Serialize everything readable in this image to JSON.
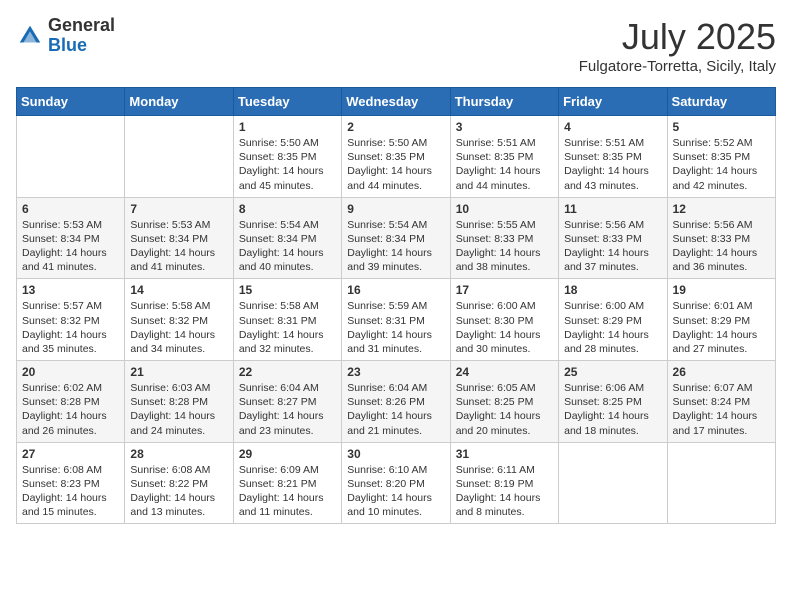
{
  "logo": {
    "general": "General",
    "blue": "Blue"
  },
  "title": "July 2025",
  "location": "Fulgatore-Torretta, Sicily, Italy",
  "days_of_week": [
    "Sunday",
    "Monday",
    "Tuesday",
    "Wednesday",
    "Thursday",
    "Friday",
    "Saturday"
  ],
  "weeks": [
    [
      {
        "day": "",
        "sunrise": "",
        "sunset": "",
        "daylight": ""
      },
      {
        "day": "",
        "sunrise": "",
        "sunset": "",
        "daylight": ""
      },
      {
        "day": "1",
        "sunrise": "Sunrise: 5:50 AM",
        "sunset": "Sunset: 8:35 PM",
        "daylight": "Daylight: 14 hours and 45 minutes."
      },
      {
        "day": "2",
        "sunrise": "Sunrise: 5:50 AM",
        "sunset": "Sunset: 8:35 PM",
        "daylight": "Daylight: 14 hours and 44 minutes."
      },
      {
        "day": "3",
        "sunrise": "Sunrise: 5:51 AM",
        "sunset": "Sunset: 8:35 PM",
        "daylight": "Daylight: 14 hours and 44 minutes."
      },
      {
        "day": "4",
        "sunrise": "Sunrise: 5:51 AM",
        "sunset": "Sunset: 8:35 PM",
        "daylight": "Daylight: 14 hours and 43 minutes."
      },
      {
        "day": "5",
        "sunrise": "Sunrise: 5:52 AM",
        "sunset": "Sunset: 8:35 PM",
        "daylight": "Daylight: 14 hours and 42 minutes."
      }
    ],
    [
      {
        "day": "6",
        "sunrise": "Sunrise: 5:53 AM",
        "sunset": "Sunset: 8:34 PM",
        "daylight": "Daylight: 14 hours and 41 minutes."
      },
      {
        "day": "7",
        "sunrise": "Sunrise: 5:53 AM",
        "sunset": "Sunset: 8:34 PM",
        "daylight": "Daylight: 14 hours and 41 minutes."
      },
      {
        "day": "8",
        "sunrise": "Sunrise: 5:54 AM",
        "sunset": "Sunset: 8:34 PM",
        "daylight": "Daylight: 14 hours and 40 minutes."
      },
      {
        "day": "9",
        "sunrise": "Sunrise: 5:54 AM",
        "sunset": "Sunset: 8:34 PM",
        "daylight": "Daylight: 14 hours and 39 minutes."
      },
      {
        "day": "10",
        "sunrise": "Sunrise: 5:55 AM",
        "sunset": "Sunset: 8:33 PM",
        "daylight": "Daylight: 14 hours and 38 minutes."
      },
      {
        "day": "11",
        "sunrise": "Sunrise: 5:56 AM",
        "sunset": "Sunset: 8:33 PM",
        "daylight": "Daylight: 14 hours and 37 minutes."
      },
      {
        "day": "12",
        "sunrise": "Sunrise: 5:56 AM",
        "sunset": "Sunset: 8:33 PM",
        "daylight": "Daylight: 14 hours and 36 minutes."
      }
    ],
    [
      {
        "day": "13",
        "sunrise": "Sunrise: 5:57 AM",
        "sunset": "Sunset: 8:32 PM",
        "daylight": "Daylight: 14 hours and 35 minutes."
      },
      {
        "day": "14",
        "sunrise": "Sunrise: 5:58 AM",
        "sunset": "Sunset: 8:32 PM",
        "daylight": "Daylight: 14 hours and 34 minutes."
      },
      {
        "day": "15",
        "sunrise": "Sunrise: 5:58 AM",
        "sunset": "Sunset: 8:31 PM",
        "daylight": "Daylight: 14 hours and 32 minutes."
      },
      {
        "day": "16",
        "sunrise": "Sunrise: 5:59 AM",
        "sunset": "Sunset: 8:31 PM",
        "daylight": "Daylight: 14 hours and 31 minutes."
      },
      {
        "day": "17",
        "sunrise": "Sunrise: 6:00 AM",
        "sunset": "Sunset: 8:30 PM",
        "daylight": "Daylight: 14 hours and 30 minutes."
      },
      {
        "day": "18",
        "sunrise": "Sunrise: 6:00 AM",
        "sunset": "Sunset: 8:29 PM",
        "daylight": "Daylight: 14 hours and 28 minutes."
      },
      {
        "day": "19",
        "sunrise": "Sunrise: 6:01 AM",
        "sunset": "Sunset: 8:29 PM",
        "daylight": "Daylight: 14 hours and 27 minutes."
      }
    ],
    [
      {
        "day": "20",
        "sunrise": "Sunrise: 6:02 AM",
        "sunset": "Sunset: 8:28 PM",
        "daylight": "Daylight: 14 hours and 26 minutes."
      },
      {
        "day": "21",
        "sunrise": "Sunrise: 6:03 AM",
        "sunset": "Sunset: 8:28 PM",
        "daylight": "Daylight: 14 hours and 24 minutes."
      },
      {
        "day": "22",
        "sunrise": "Sunrise: 6:04 AM",
        "sunset": "Sunset: 8:27 PM",
        "daylight": "Daylight: 14 hours and 23 minutes."
      },
      {
        "day": "23",
        "sunrise": "Sunrise: 6:04 AM",
        "sunset": "Sunset: 8:26 PM",
        "daylight": "Daylight: 14 hours and 21 minutes."
      },
      {
        "day": "24",
        "sunrise": "Sunrise: 6:05 AM",
        "sunset": "Sunset: 8:25 PM",
        "daylight": "Daylight: 14 hours and 20 minutes."
      },
      {
        "day": "25",
        "sunrise": "Sunrise: 6:06 AM",
        "sunset": "Sunset: 8:25 PM",
        "daylight": "Daylight: 14 hours and 18 minutes."
      },
      {
        "day": "26",
        "sunrise": "Sunrise: 6:07 AM",
        "sunset": "Sunset: 8:24 PM",
        "daylight": "Daylight: 14 hours and 17 minutes."
      }
    ],
    [
      {
        "day": "27",
        "sunrise": "Sunrise: 6:08 AM",
        "sunset": "Sunset: 8:23 PM",
        "daylight": "Daylight: 14 hours and 15 minutes."
      },
      {
        "day": "28",
        "sunrise": "Sunrise: 6:08 AM",
        "sunset": "Sunset: 8:22 PM",
        "daylight": "Daylight: 14 hours and 13 minutes."
      },
      {
        "day": "29",
        "sunrise": "Sunrise: 6:09 AM",
        "sunset": "Sunset: 8:21 PM",
        "daylight": "Daylight: 14 hours and 11 minutes."
      },
      {
        "day": "30",
        "sunrise": "Sunrise: 6:10 AM",
        "sunset": "Sunset: 8:20 PM",
        "daylight": "Daylight: 14 hours and 10 minutes."
      },
      {
        "day": "31",
        "sunrise": "Sunrise: 6:11 AM",
        "sunset": "Sunset: 8:19 PM",
        "daylight": "Daylight: 14 hours and 8 minutes."
      },
      {
        "day": "",
        "sunrise": "",
        "sunset": "",
        "daylight": ""
      },
      {
        "day": "",
        "sunrise": "",
        "sunset": "",
        "daylight": ""
      }
    ]
  ]
}
